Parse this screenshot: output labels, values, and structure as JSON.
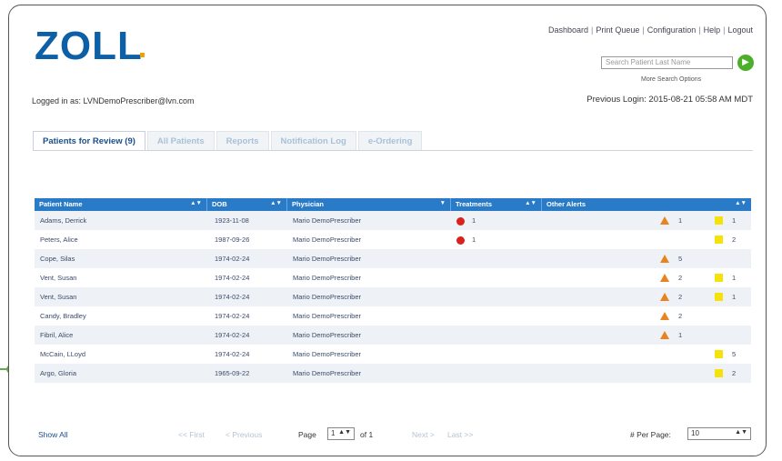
{
  "brand": {
    "logo_text": "ZOLL",
    "logo_color": "#0d5fa6",
    "accent_dot_color": "#f0a000"
  },
  "header": {
    "links": [
      "Dashboard",
      "Print Queue",
      "Configuration",
      "Help",
      "Logout"
    ],
    "search_placeholder": "Search Patient Last Name",
    "go_icon": "go-arrow-icon",
    "more_search": "More Search Options",
    "logged_in": "Logged in as: LVNDemoPrescriber@lvn.com",
    "previous_login": "Previous Login: 2015-08-21 05:58 AM MDT"
  },
  "tabs": [
    {
      "label": "Patients for Review (9)",
      "active": true
    },
    {
      "label": "All Patients",
      "active": false
    },
    {
      "label": "Reports",
      "active": false
    },
    {
      "label": "Notification Log",
      "active": false
    },
    {
      "label": "e-Ordering",
      "active": false
    }
  ],
  "table": {
    "header_color": "#2a7bc7",
    "columns": [
      "Patient Name",
      "DOB",
      "Physician",
      "Treatments",
      "Other Alerts"
    ],
    "rows": [
      {
        "name": "Adams, Derrick",
        "dob": "1923-11-08",
        "physician": "Mario DemoPrescriber",
        "treatments": "1",
        "orange": "1",
        "yellow": "1"
      },
      {
        "name": "Peters, Alice",
        "dob": "1987-09-26",
        "physician": "Mario DemoPrescriber",
        "treatments": "1",
        "orange": "",
        "yellow": "2"
      },
      {
        "name": "Cope, Silas",
        "dob": "1974-02-24",
        "physician": "Mario DemoPrescriber",
        "treatments": "",
        "orange": "5",
        "yellow": ""
      },
      {
        "name": "Vent, Susan",
        "dob": "1974-02-24",
        "physician": "Mario DemoPrescriber",
        "treatments": "",
        "orange": "2",
        "yellow": "1"
      },
      {
        "name": "Vent, Susan",
        "dob": "1974-02-24",
        "physician": "Mario DemoPrescriber",
        "treatments": "",
        "orange": "2",
        "yellow": "1"
      },
      {
        "name": "Candy, Bradley",
        "dob": "1974-02-24",
        "physician": "Mario DemoPrescriber",
        "treatments": "",
        "orange": "2",
        "yellow": ""
      },
      {
        "name": "Fibril, Alice",
        "dob": "1974-02-24",
        "physician": "Mario DemoPrescriber",
        "treatments": "",
        "orange": "1",
        "yellow": ""
      },
      {
        "name": "McCain, LLoyd",
        "dob": "1974-02-24",
        "physician": "Mario DemoPrescriber",
        "treatments": "",
        "orange": "",
        "yellow": "5"
      },
      {
        "name": "Argo, Gloria",
        "dob": "1965-09-22",
        "physician": "Mario DemoPrescriber",
        "treatments": "",
        "orange": "",
        "yellow": "2"
      }
    ]
  },
  "pager": {
    "show_all": "Show All",
    "first": "<< First",
    "previous": "< Previous",
    "page_label": "Page",
    "page_value": "1",
    "of_label": "of 1",
    "next": "Next >",
    "last": "Last >>",
    "per_page_label": "# Per Page:",
    "per_page_value": "10"
  }
}
